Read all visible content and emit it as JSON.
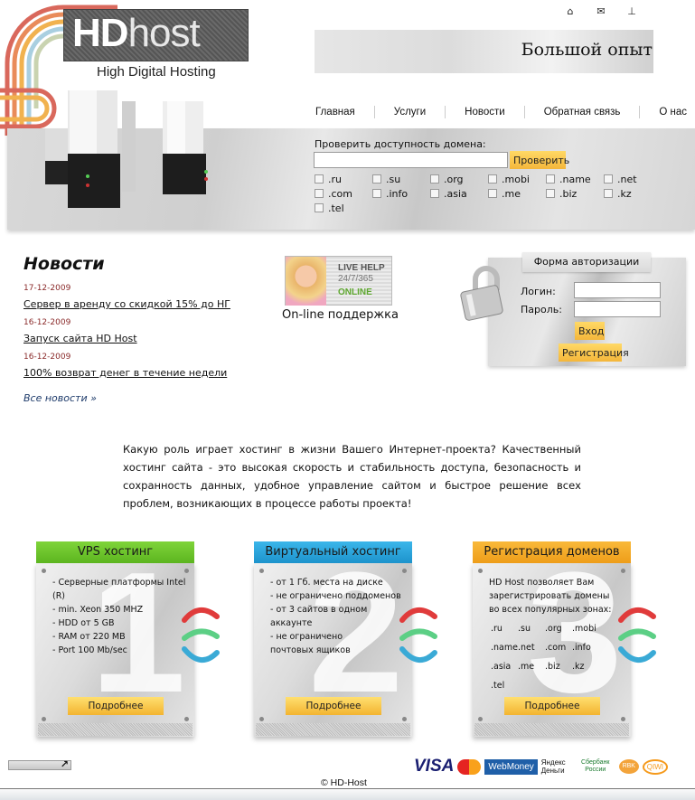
{
  "header": {
    "logo_primary": "HD",
    "logo_secondary": "host",
    "tagline": "High Digital Hosting",
    "slogan": "Большой опыт",
    "top_icons": [
      {
        "name": "home-icon",
        "glyph": "⌂"
      },
      {
        "name": "mail-icon",
        "glyph": "✉"
      },
      {
        "name": "sitemap-icon",
        "glyph": "⊥"
      }
    ],
    "nav": [
      "Главная",
      "Услуги",
      "Новости",
      "Обратная связь",
      "О нас"
    ]
  },
  "domain_check": {
    "label": "Проверить доступность домена:",
    "input_value": "",
    "button": "Проверить",
    "tlds": [
      ".ru",
      ".su",
      ".org",
      ".mobi",
      ".name",
      ".net",
      ".com",
      ".info",
      ".asia",
      ".me",
      ".biz",
      ".kz",
      ".tel"
    ]
  },
  "news": {
    "title": "Новости",
    "items": [
      {
        "date": "17-12-2009",
        "title": "Сервер в аренду со скидкой 15% до НГ"
      },
      {
        "date": "16-12-2009",
        "title": "Запуск сайта HD Host"
      },
      {
        "date": "16-12-2009",
        "title": "100% возврат денег в течение недели"
      }
    ],
    "all_link": "Все новости »"
  },
  "live_help": {
    "line1": "LIVE HELP",
    "line2": "24/7/365",
    "line3": "ONLINE",
    "caption": "On-line поддержка"
  },
  "auth": {
    "title": "Форма авторизации",
    "login_label": "Логин:",
    "password_label": "Пароль:",
    "login_value": "",
    "password_value": "",
    "enter_button": "Вход",
    "register_button": "Регистрация"
  },
  "intro": "Какую роль играет хостинг в жизни Вашего Интернет-проекта? Качественный хостинг сайта - это высокая скорость и стабильность доступа, безопасность и сохранность данных, удобное управление сайтом и быстрое решение всех проблем, возникающих в процессе работы проекта!",
  "cards": [
    {
      "title": "VPS хостинг",
      "number": "1",
      "color": "#6cc62a",
      "items": [
        "- Серверные платформы Intel (R)",
        "- min. Xeon 350 MHZ",
        "- HDD от 5 GB",
        "- RAM от 220 MB",
        "- Port 100 Mb/sec"
      ],
      "more": "Подробнее"
    },
    {
      "title": "Виртуальный хостинг",
      "number": "2",
      "color": "#2aa3dc",
      "items": [
        "- от 1 Гб. места на диске",
        "- не ограничено поддоменов",
        "- от 3 сайтов в одном аккаунте",
        "- не ограничено почтовых ящиков"
      ],
      "more": "Подробнее"
    },
    {
      "title": "Регистрация доменов",
      "number": "3",
      "color": "#f2a623",
      "intro": "HD Host позволяет Вам зарегистрировать домены во всех популярных зонах:",
      "tlds": [
        ".ru",
        ".su",
        ".org",
        ".mobi",
        ".name",
        ".net",
        ".com",
        ".info",
        ".asia",
        ".me",
        ".biz",
        ".kz",
        ".tel"
      ],
      "more": "Подробнее"
    }
  ],
  "footer": {
    "payments": [
      "VISA",
      "MasterCard",
      "WebMoney",
      "Яндекс Деньги",
      "Сбербанк России",
      "RBK Money",
      "QIWI"
    ],
    "copyright": "© HD-Host"
  }
}
